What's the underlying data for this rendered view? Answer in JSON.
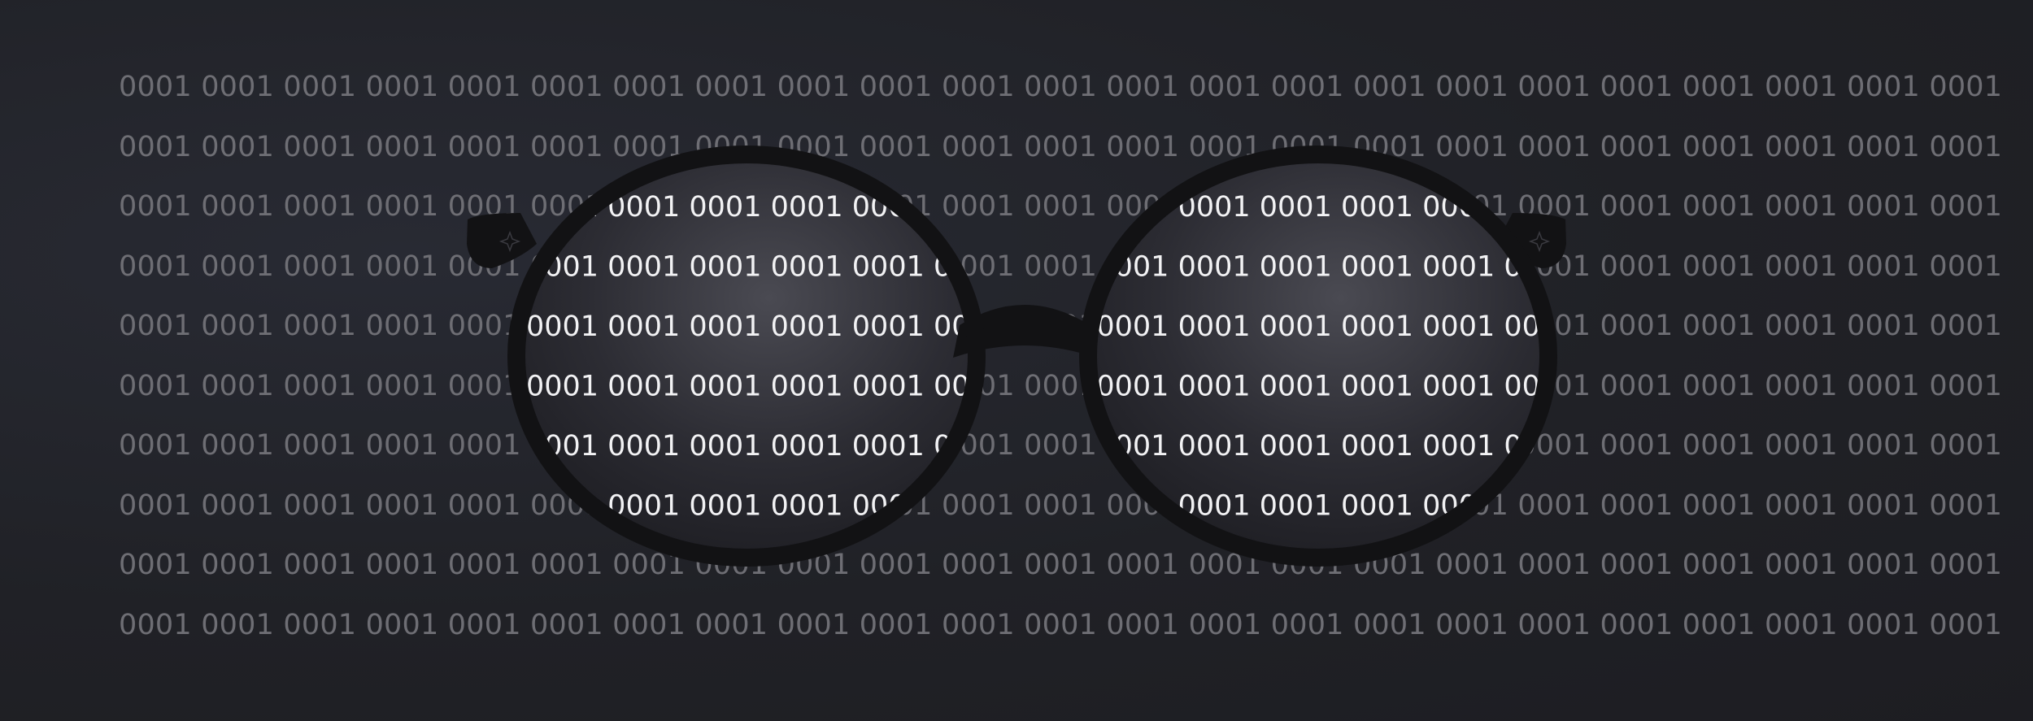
{
  "scene": {
    "description_free": true,
    "background_color": "#1f1f24",
    "code_text_color": "#6e6e74",
    "lens_text_color": "#f2f2f4",
    "frame_color": "#111113",
    "code_token": "0001",
    "rows": [
      "0001 0001 0001 0001 0001 0001 0001 0001 0001 0001 0001 0001 0001 0001 0001 0001 0001 0001 0001 0001 0001 0001 0001",
      "0001 0001 0001 0001 0001 0001 0001 0001 0001 0001 0001 0001 0001 0001 0001 0001 0001 0001 0001 0001 0001 0001 0001",
      "0001 0001 0001 0001 0001 0001 0001 0001 0001 0001 0001 0001 0001 0001 0001 0001 0001 0001 0001 0001 0001 0001 0001",
      "0001 0001 0001 0001 0001 0001 0001 0001 0001 0001 0001 0001 0001 0001 0001 0001 0001 0001 0001 0001 0001 0001 0001",
      "0001 0001 0001 0001 0001 0001 0001 0001 0001 0001 0001 0001 0001 0001 0001 0001 0001 0001 0001 0001 0001 0001 0001",
      "0001 0001 0001 0001 0001 0001 0001 0001 0001 0001 0001 0001 0001 0001 0001 0001 0001 0001 0001 0001 0001 0001 0001",
      "0001 0001 0001 0001 0001 0001 0001 0001 0001 0001 0001 0001 0001 0001 0001 0001 0001 0001 0001 0001 0001 0001 0001",
      "0001 0001 0001 0001 0001 0001 0001 0001 0001 0001 0001 0001 0001 0001 0001 0001 0001 0001 0001 0001 0001 0001 0001",
      "0001 0001 0001 0001 0001 0001 0001 0001 0001 0001 0001 0001 0001 0001 0001 0001 0001 0001 0001 0001 0001 0001 0001",
      "0001 0001 0001 0001 0001 0001 0001 0001 0001 0001 0001 0001 0001 0001 0001 0001 0001 0001 0001 0001 0001 0001 0001"
    ]
  }
}
